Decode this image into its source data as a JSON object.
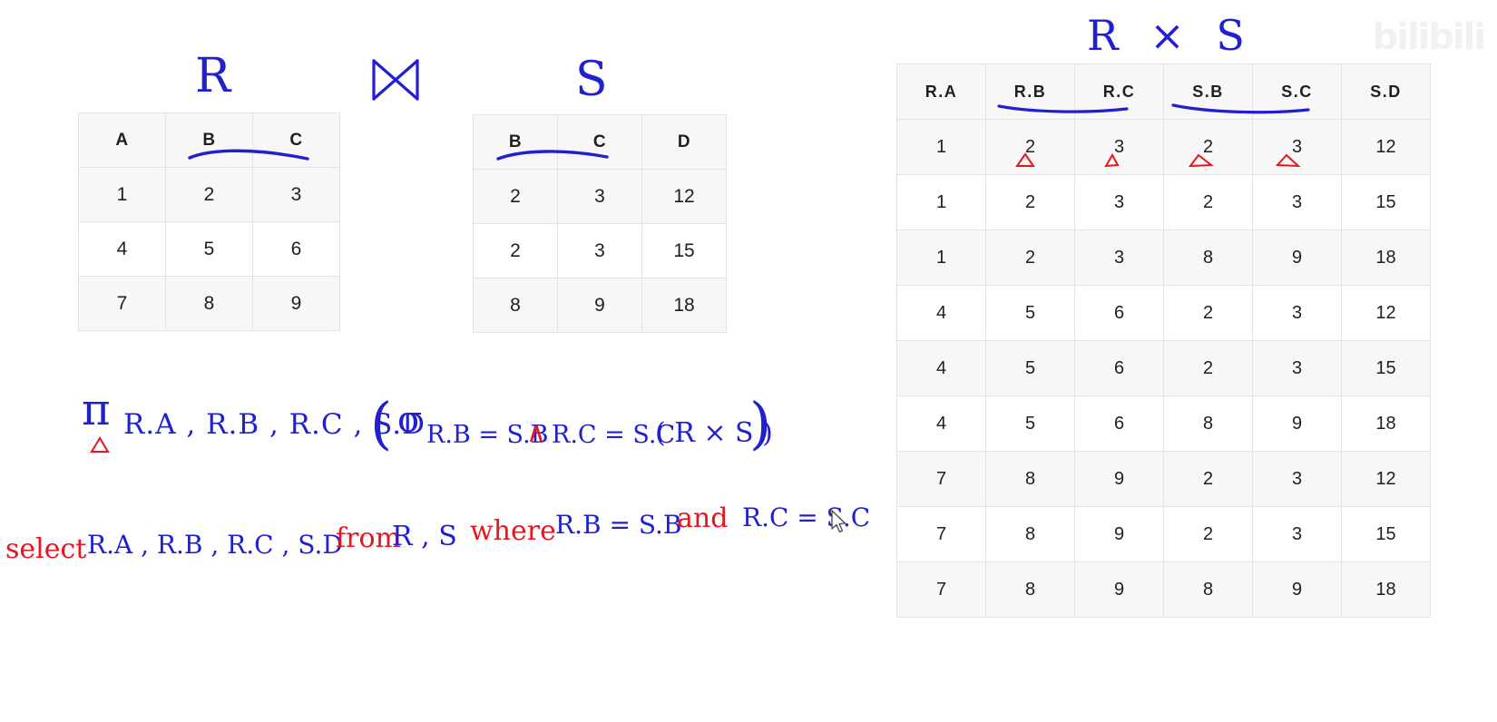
{
  "background": "#ffffff",
  "colors": {
    "ink_blue": "#2020d0",
    "ink_red": "#e8141e",
    "table_border": "#e3e3e3",
    "header_fill": "#f7f7f7",
    "stripe_fill": "#f7f7f7",
    "text": "#1f1f1f",
    "watermark": "#f1f1f1"
  },
  "watermark": {
    "text": "bilibili"
  },
  "labels": {
    "relation_R": "R",
    "relation_S": "S",
    "join_symbol": "⋈",
    "cross_product_title": "R × S"
  },
  "table_R": {
    "name": "R",
    "columns": [
      "A",
      "B",
      "C"
    ],
    "underlined_columns": [
      "B",
      "C"
    ],
    "rows": [
      [
        "1",
        "2",
        "3"
      ],
      [
        "4",
        "5",
        "6"
      ],
      [
        "7",
        "8",
        "9"
      ]
    ]
  },
  "table_S": {
    "name": "S",
    "columns": [
      "B",
      "C",
      "D"
    ],
    "underlined_columns": [
      "B",
      "C"
    ],
    "rows": [
      [
        "2",
        "3",
        "12"
      ],
      [
        "2",
        "3",
        "15"
      ],
      [
        "8",
        "9",
        "18"
      ]
    ]
  },
  "table_RxS": {
    "name": "R × S",
    "columns": [
      "R.A",
      "R.B",
      "R.C",
      "S.B",
      "S.C",
      "S.D"
    ],
    "underlined_columns": [
      "R.B",
      "R.C",
      "S.B",
      "S.C"
    ],
    "marked_first_row_columns": [
      "R.B",
      "R.C",
      "S.B",
      "S.C"
    ],
    "rows": [
      [
        "1",
        "2",
        "3",
        "2",
        "3",
        "12"
      ],
      [
        "1",
        "2",
        "3",
        "2",
        "3",
        "15"
      ],
      [
        "1",
        "2",
        "3",
        "8",
        "9",
        "18"
      ],
      [
        "4",
        "5",
        "6",
        "2",
        "3",
        "12"
      ],
      [
        "4",
        "5",
        "6",
        "2",
        "3",
        "15"
      ],
      [
        "4",
        "5",
        "6",
        "8",
        "9",
        "18"
      ],
      [
        "7",
        "8",
        "9",
        "2",
        "3",
        "12"
      ],
      [
        "7",
        "8",
        "9",
        "2",
        "3",
        "15"
      ],
      [
        "7",
        "8",
        "9",
        "8",
        "9",
        "18"
      ]
    ]
  },
  "relational_algebra": {
    "projection_symbol": "π",
    "projection_attributes": "R.A , R.B , R.C , S.D",
    "open_paren": "(",
    "selection_symbol": "σ",
    "selection_condition_left": "R.B = S.B",
    "and_symbol": "∧",
    "selection_condition_right": "R.C = S.C",
    "operand": "( R × S )",
    "close_paren": ")"
  },
  "sql_query": {
    "keyword_select": "select",
    "columns": "R.A , R.B , R.C , S.D",
    "keyword_from": "from",
    "tables": "R , S",
    "keyword_where": "where",
    "condition_left": "R.B = S.B",
    "keyword_and": "and",
    "condition_right": "R.C = S.C"
  }
}
